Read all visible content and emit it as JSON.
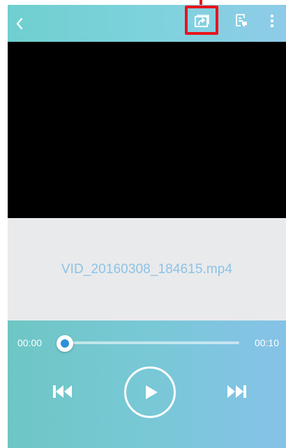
{
  "toolbar": {
    "back_icon": "chevron-left-icon",
    "cast_icon": "share-to-screen-icon",
    "details_icon": "details-icon",
    "more_icon": "more-vertical-icon",
    "highlight_color": "#e8141c"
  },
  "media": {
    "file_name": "VID_20160308_184615.mp4"
  },
  "playback": {
    "current_time": "00:00",
    "total_time": "00:10",
    "progress": 0,
    "prev_icon": "skip-previous-icon",
    "play_icon": "play-icon",
    "next_icon": "skip-next-icon",
    "accent_color": "#2f8fd8"
  }
}
